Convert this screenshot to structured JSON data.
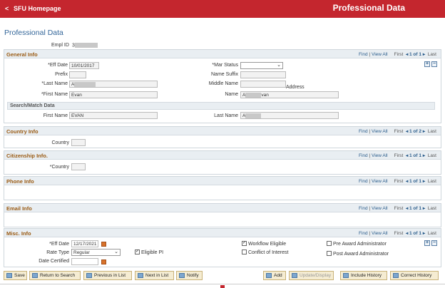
{
  "topbar": {
    "back_glyph": "<",
    "home_label": "SFU Homepage",
    "title": "Professional Data"
  },
  "page_title": "Professional Data",
  "empl": {
    "label": "Empl ID",
    "value": "3"
  },
  "general_info": {
    "title": "General Info",
    "nav": {
      "find": "Find",
      "view_all": "View All",
      "first": "First",
      "count": "1 of 1",
      "last": "Last"
    },
    "eff_date_label": "*Eff Date",
    "eff_date": "10/01/2017",
    "mar_status_label": "*Mar Status",
    "prefix_label": "Prefix",
    "name_suffix_label": "Name Suffix",
    "last_name_label": "*Last Name",
    "last_name": "A",
    "middle_name_label": "Middle Name",
    "address_label": "Address",
    "first_name_label": "*First Name",
    "first_name": "Evan",
    "name_label": "Name",
    "name_prefix": "A",
    "name_suffix": "van",
    "search_match": {
      "title": "Search/Match Data",
      "first_name_label": "First Name",
      "first_name": "EVAN",
      "last_name_label": "Last Name",
      "last_name": "A"
    }
  },
  "country_info": {
    "title": "Country Info",
    "nav": {
      "find": "Find",
      "view_all": "View All",
      "first": "First",
      "count": "1 of 2",
      "last": "Last"
    },
    "country_label": "Country"
  },
  "citizenship_info": {
    "title": "Citizenship Info.",
    "nav": {
      "find": "Find",
      "view_all": "View All",
      "first": "First",
      "count": "1 of 1",
      "last": "Last"
    },
    "country_label": "*Country"
  },
  "phone_info": {
    "title": "Phone Info",
    "nav": {
      "find": "Find",
      "view_all": "View All",
      "first": "First",
      "count": "1 of 1",
      "last": "Last"
    }
  },
  "email_info": {
    "title": "Email Info",
    "nav": {
      "find": "Find",
      "view_all": "View All",
      "first": "First",
      "count": "1 of 1",
      "last": "Last"
    }
  },
  "misc_info": {
    "title": "Misc. Info",
    "nav": {
      "find": "Find",
      "view_all": "View All",
      "first": "First",
      "count": "1 of 1",
      "last": "Last"
    },
    "eff_date_label": "*Eff Date",
    "eff_date": "12/17/2021",
    "rate_type_label": "Rate Type",
    "rate_type": "Regular",
    "eligible_pi_label": "Eligible PI",
    "eligible_pi_checked": true,
    "date_certified_label": "Date Certified",
    "workflow_eligible_label": "Workflow Eligible",
    "workflow_eligible_checked": true,
    "conflict_label": "Conflict of Interest",
    "conflict_checked": false,
    "pre_award_label": "Pre Award Administrator",
    "pre_award_checked": false,
    "post_award_label": "Post Award Administrator",
    "post_award_checked": false
  },
  "buttons": {
    "save": "Save",
    "return_to_search": "Return to Search",
    "previous_in_list": "Previous in List",
    "next_in_list": "Next in List",
    "notify": "Notify",
    "add": "Add",
    "update_display": "Update/Display",
    "include_history": "Include History",
    "correct_history": "Correct History"
  },
  "plus_glyph": "+",
  "minus_glyph": "−",
  "check_glyph": "✓"
}
